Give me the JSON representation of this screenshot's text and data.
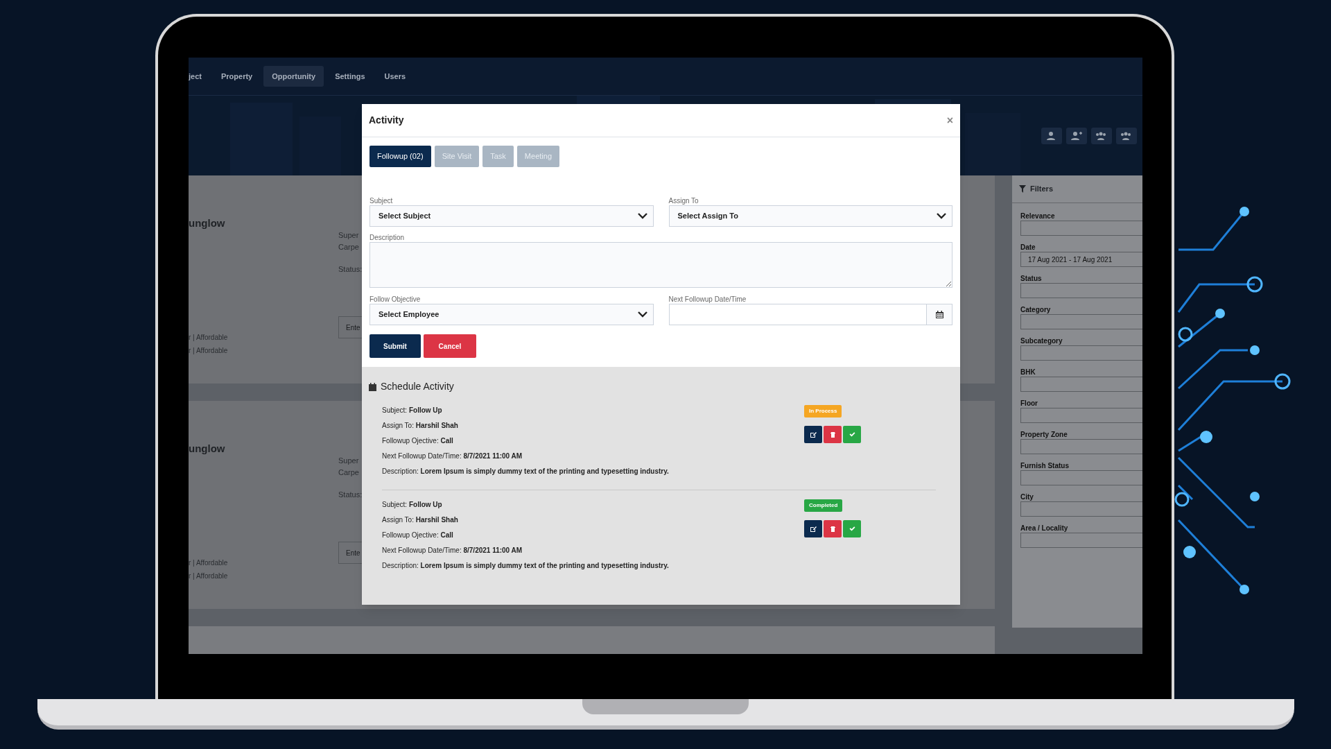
{
  "nav": [
    {
      "label": "ject",
      "selected": false
    },
    {
      "label": "Property",
      "selected": false
    },
    {
      "label": "Opportunity",
      "selected": true
    },
    {
      "label": "Settings",
      "selected": false
    },
    {
      "label": "Users",
      "selected": false
    }
  ],
  "background_cards": [
    {
      "title": "unglow",
      "fields": [
        "Super",
        "Carpe",
        "Status:"
      ],
      "tags": [
        "r | Affordable",
        "r | Affordable"
      ],
      "input_placeholder": "Ente"
    },
    {
      "title": "unglow",
      "fields": [
        "Super",
        "Carpe",
        "Status:"
      ],
      "tags": [
        "r | Affordable",
        "r | Affordable"
      ],
      "input_placeholder": "Ente"
    }
  ],
  "filters": {
    "title": "Filters",
    "fields": [
      {
        "label": "Relevance"
      },
      {
        "label": "Date",
        "value": "17 Aug 2021 - 17 Aug 2021"
      },
      {
        "label": "Status"
      },
      {
        "label": "Category"
      },
      {
        "label": "Subcategory"
      },
      {
        "label": "BHK"
      },
      {
        "label": "Floor"
      },
      {
        "label": "Property Zone"
      },
      {
        "label": "Furnish Status"
      },
      {
        "label": "City"
      },
      {
        "label": "Area / Locality"
      }
    ]
  },
  "modal": {
    "title": "Activity",
    "close": "×",
    "tabs": [
      {
        "label": "Followup (02)",
        "selected": true
      },
      {
        "label": "Site Visit",
        "selected": false
      },
      {
        "label": "Task",
        "selected": false
      },
      {
        "label": "Meeting",
        "selected": false
      }
    ],
    "form": {
      "subject": {
        "label": "Subject",
        "value": "Select Subject"
      },
      "assign_to": {
        "label": "Assign To",
        "value": "Select Assign To"
      },
      "description": {
        "label": "Description"
      },
      "follow_objective": {
        "label": "Follow Objective",
        "value": "Select Employee"
      },
      "next_followup": {
        "label": "Next Followup Date/Time"
      }
    },
    "buttons": [
      {
        "label": "Submit",
        "kind": "primary"
      },
      {
        "label": "Cancel",
        "kind": "danger"
      }
    ],
    "schedule": {
      "title": "Schedule Activity",
      "items": [
        {
          "status": "In Process",
          "color": "#f5a623",
          "lines": [
            "Subject: **Follow Up**",
            "Assign To: **Harshil Shah**",
            "Followup Ojective: **Call**",
            "Next Followup Date/Time: **8/7/2021 11:00 AM**",
            "Description: **Lorem Ipsum is simply dummy text of the printing and typesetting industry.**"
          ]
        },
        {
          "status": "Completed",
          "color": "#28a745",
          "lines": [
            "Subject: **Follow Up**",
            "Assign To: **Harshil Shah**",
            "Followup Ojective: **Call**",
            "Next Followup Date/Time: **8/7/2021 11:00 AM**",
            "Description: **Lorem Ipsum is simply dummy text of the printing and typesetting industry.**"
          ]
        }
      ]
    }
  }
}
